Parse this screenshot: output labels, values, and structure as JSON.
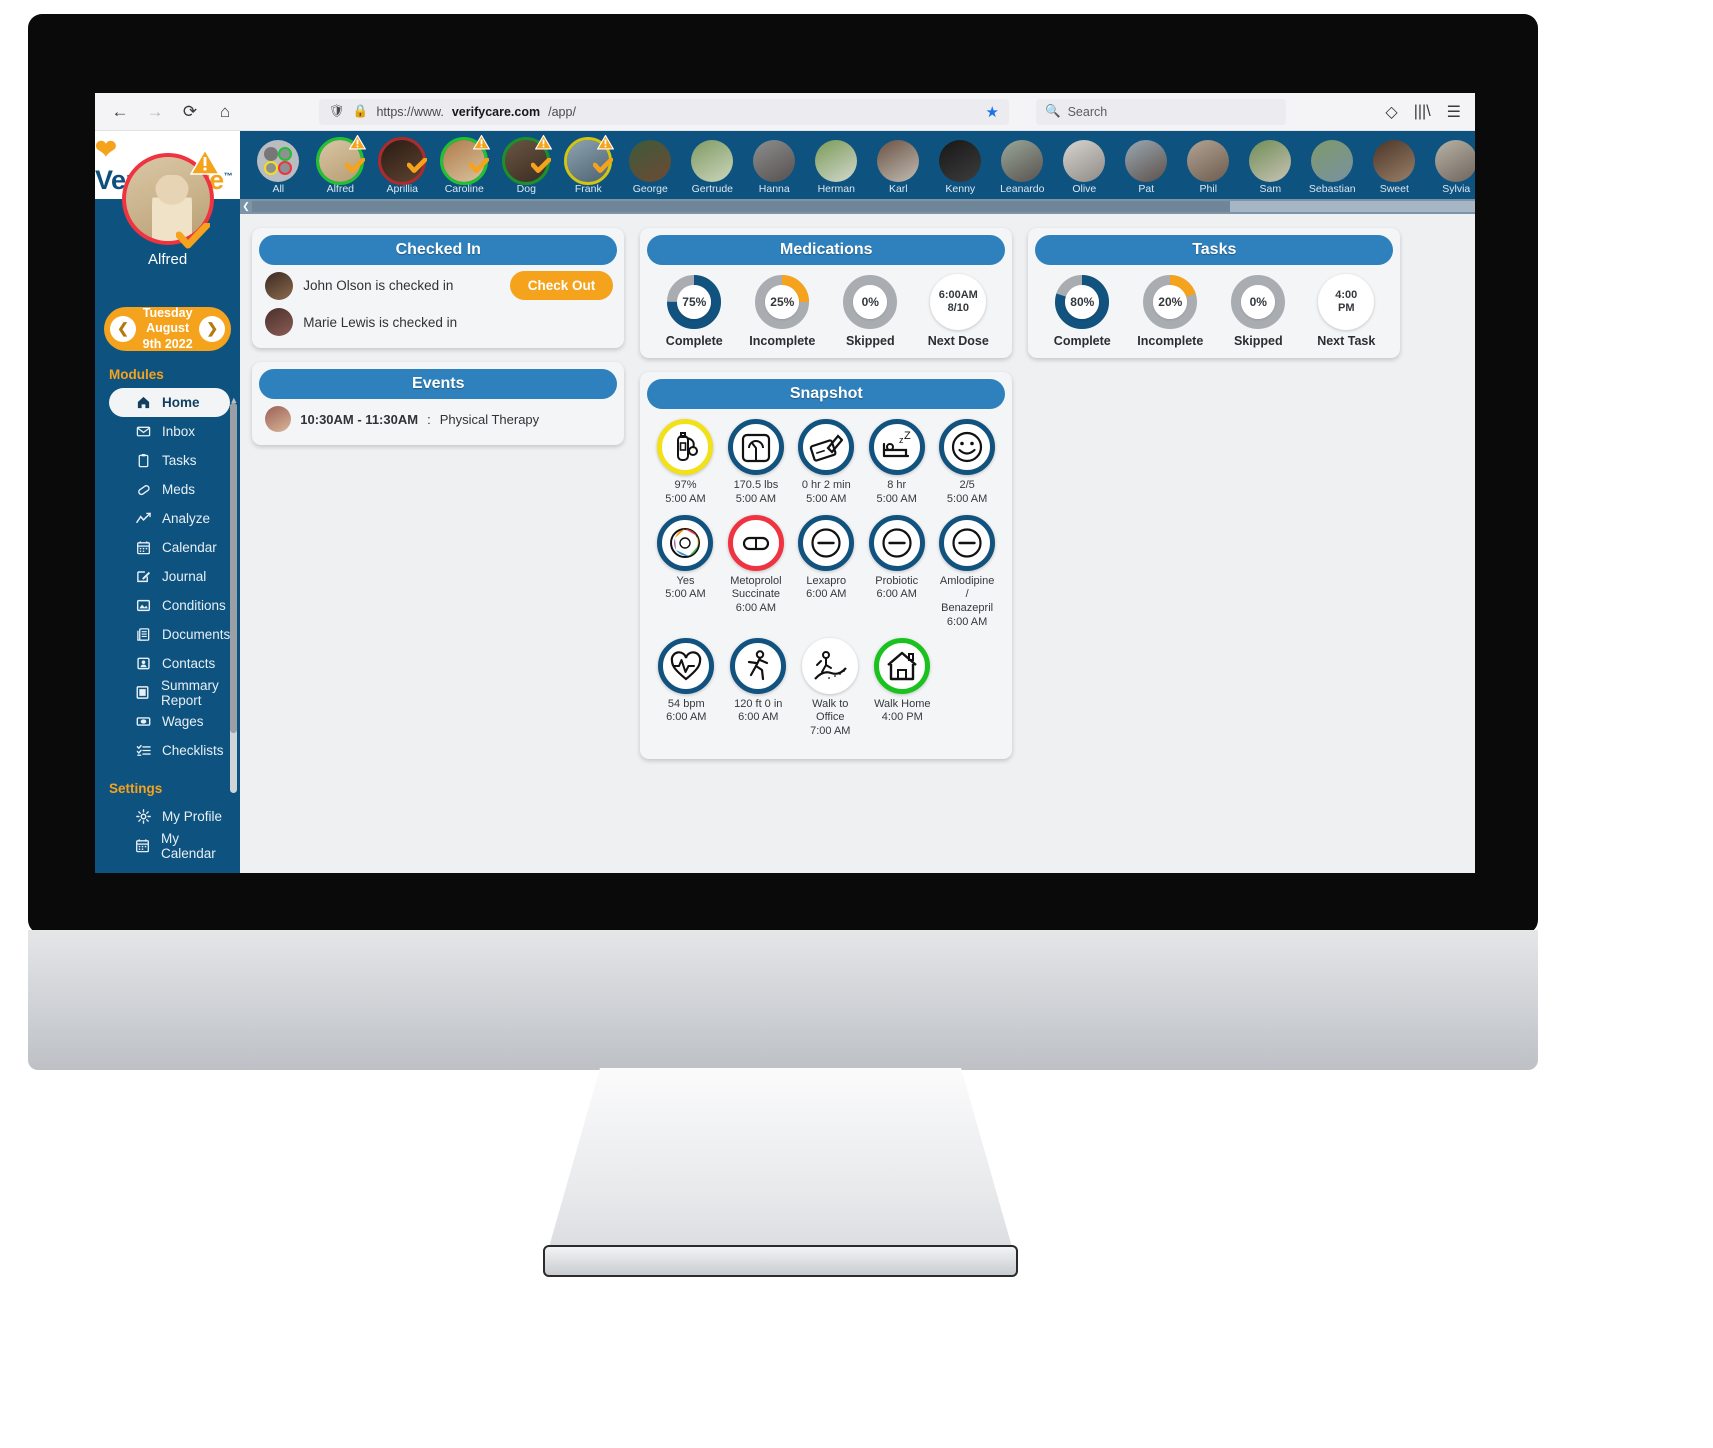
{
  "browser": {
    "back_icon": "back-arrow-icon",
    "forward_icon": "forward-arrow-icon",
    "reload_icon": "reload-icon",
    "home_icon": "home-icon",
    "url_prefix": "https://www.",
    "url_host": "verifycare.com",
    "url_path": "/app/",
    "shield_icon": "shield-icon",
    "lock_icon": "lock-icon",
    "bookmark_star_icon": "star-icon",
    "search_placeholder": "Search",
    "search_icon": "search-icon",
    "pocket_icon": "pocket-icon",
    "library_icon": "library-icon",
    "menu_icon": "hamburger-menu-icon"
  },
  "brand": {
    "name_v": "V",
    "name_erify": "erify",
    "name_care": "Care",
    "tm": "™"
  },
  "profile": {
    "name": "Alfred",
    "date_day": "Tuesday",
    "date_full": "August 9th 2022",
    "prev_icon": "chevron-left-icon",
    "next_icon": "chevron-right-icon",
    "alert_icon": "warning-triangle-icon",
    "verified_icon": "check-mark-icon"
  },
  "sidebar": {
    "modules_label": "Modules",
    "settings_label": "Settings",
    "modules": [
      {
        "label": "Home",
        "icon": "home-icon",
        "active": true
      },
      {
        "label": "Inbox",
        "icon": "envelope-icon",
        "active": false
      },
      {
        "label": "Tasks",
        "icon": "clipboard-icon",
        "active": false
      },
      {
        "label": "Meds",
        "icon": "pill-icon",
        "active": false
      },
      {
        "label": "Analyze",
        "icon": "chart-line-icon",
        "active": false
      },
      {
        "label": "Calendar",
        "icon": "calendar-icon",
        "active": false
      },
      {
        "label": "Journal",
        "icon": "pencil-square-icon",
        "active": false
      },
      {
        "label": "Conditions",
        "icon": "image-frame-icon",
        "active": false
      },
      {
        "label": "Documents",
        "icon": "documents-icon",
        "active": false
      },
      {
        "label": "Contacts",
        "icon": "contact-card-icon",
        "active": false
      },
      {
        "label": "Summary Report",
        "icon": "report-icon",
        "active": false
      },
      {
        "label": "Wages",
        "icon": "money-icon",
        "active": false
      },
      {
        "label": "Checklists",
        "icon": "checklist-icon",
        "active": false
      }
    ],
    "settings": [
      {
        "label": "My Profile",
        "icon": "gear-icon"
      },
      {
        "label": "My Calendar",
        "icon": "calendar-icon"
      }
    ]
  },
  "patients": [
    {
      "label": "All",
      "ring": "none",
      "warn": false,
      "check": false,
      "c1": "#cfd2d5",
      "c2": "#b4b8bc"
    },
    {
      "label": "Alfred",
      "ring": "#22c132",
      "warn": true,
      "check": true,
      "c1": "#d8c6a4",
      "c2": "#b79d73"
    },
    {
      "label": "Aprillia",
      "ring": "#b02a2a",
      "warn": false,
      "check": true,
      "c1": "#2a1b13",
      "c2": "#5e4330"
    },
    {
      "label": "Caroline",
      "ring": "#22c132",
      "warn": true,
      "check": true,
      "c1": "#b07a4a",
      "c2": "#d9c39e"
    },
    {
      "label": "Dog",
      "ring": "#1f8f2a",
      "warn": true,
      "check": true,
      "c1": "#6b5542",
      "c2": "#3b2d22"
    },
    {
      "label": "Frank",
      "ring": "#d2c413",
      "warn": true,
      "check": true,
      "c1": "#8fa3b2",
      "c2": "#4d6372"
    },
    {
      "label": "George",
      "ring": "none",
      "warn": false,
      "check": false,
      "c1": "#3e5a3a",
      "c2": "#6c4a35"
    },
    {
      "label": "Gertrude",
      "ring": "none",
      "warn": false,
      "check": false,
      "c1": "#7f9a63",
      "c2": "#cbd6bb"
    },
    {
      "label": "Hanna",
      "ring": "none",
      "warn": false,
      "check": false,
      "c1": "#8e8e8e",
      "c2": "#55504f"
    },
    {
      "label": "Herman",
      "ring": "none",
      "warn": false,
      "check": false,
      "c1": "#7a9a55",
      "c2": "#d3d8cf"
    },
    {
      "label": "Karl",
      "ring": "none",
      "warn": false,
      "check": false,
      "c1": "#6a5244",
      "c2": "#c2bcb2"
    },
    {
      "label": "Kenny",
      "ring": "none",
      "warn": false,
      "check": false,
      "c1": "#171717",
      "c2": "#3d3d3d"
    },
    {
      "label": "Leanardo",
      "ring": "none",
      "warn": false,
      "check": false,
      "c1": "#9aa79a",
      "c2": "#58524e"
    },
    {
      "label": "Olive",
      "ring": "none",
      "warn": false,
      "check": false,
      "c1": "#d7d5d1",
      "c2": "#8e8a85"
    },
    {
      "label": "Pat",
      "ring": "none",
      "warn": false,
      "check": false,
      "c1": "#9aa9b4",
      "c2": "#5e5049"
    },
    {
      "label": "Phil",
      "ring": "none",
      "warn": false,
      "check": false,
      "c1": "#b2a392",
      "c2": "#6b5c50"
    },
    {
      "label": "Sam",
      "ring": "none",
      "warn": false,
      "check": false,
      "c1": "#6f8d56",
      "c2": "#c9c3b4"
    },
    {
      "label": "Sebastian",
      "ring": "none",
      "warn": false,
      "check": false,
      "c1": "#7e9a6c",
      "c2": "#79919f"
    },
    {
      "label": "Sweet",
      "ring": "none",
      "warn": false,
      "check": false,
      "c1": "#4a3527",
      "c2": "#9a8069"
    },
    {
      "label": "Sylvia",
      "ring": "none",
      "warn": false,
      "check": false,
      "c1": "#b9b2a6",
      "c2": "#6d655c"
    }
  ],
  "checked_in": {
    "title": "Checked In",
    "check_out_label": "Check Out",
    "rows": [
      {
        "text": "John Olson is checked in",
        "has_button": true,
        "c1": "#3a2a22",
        "c2": "#8d6b4e"
      },
      {
        "text": "Marie Lewis is checked in",
        "has_button": false,
        "c1": "#4b2f2a",
        "c2": "#8a5d57"
      }
    ]
  },
  "events": {
    "title": "Events",
    "rows": [
      {
        "time": "10:30AM - 11:30AM",
        "sep": ": ",
        "text": "Physical Therapy",
        "c1": "#9b5f55",
        "c2": "#d9b89a"
      }
    ]
  },
  "medications": {
    "title": "Medications",
    "cells": [
      {
        "kind": "donut",
        "value": "75%",
        "label": "Complete",
        "pct": 75,
        "color": "#12527f",
        "track": "#a9adb1"
      },
      {
        "kind": "donut",
        "value": "25%",
        "label": "Incomplete",
        "pct": 25,
        "color": "#f5a21d",
        "track": "#a9adb1"
      },
      {
        "kind": "donut",
        "value": "0%",
        "label": "Skipped",
        "pct": 0,
        "color": "#a9adb1",
        "track": "#a9adb1"
      },
      {
        "kind": "plain",
        "line1": "6:00AM",
        "line2": "8/10",
        "label": "Next Dose"
      }
    ]
  },
  "tasks": {
    "title": "Tasks",
    "cells": [
      {
        "kind": "donut",
        "value": "80%",
        "label": "Complete",
        "pct": 80,
        "color": "#12527f",
        "track": "#a9adb1"
      },
      {
        "kind": "donut",
        "value": "20%",
        "label": "Incomplete",
        "pct": 20,
        "color": "#f5a21d",
        "track": "#a9adb1"
      },
      {
        "kind": "donut",
        "value": "0%",
        "label": "Skipped",
        "pct": 0,
        "color": "#a9adb1",
        "track": "#a9adb1"
      },
      {
        "kind": "plain",
        "line1": "4:00",
        "line2": "PM",
        "label": "Next Task"
      }
    ]
  },
  "snapshot": {
    "title": "Snapshot",
    "rows": [
      [
        {
          "icon": "oxygen-tank-icon",
          "ring": "#f2e018",
          "lines": [
            "97%",
            "5:00 AM"
          ]
        },
        {
          "icon": "weight-scale-icon",
          "ring": "#12527f",
          "lines": [
            "170.5 lbs",
            "5:00 AM"
          ]
        },
        {
          "icon": "journal-pencil-icon",
          "ring": "#12527f",
          "lines": [
            "0 hr 2 min",
            "5:00 AM"
          ]
        },
        {
          "icon": "sleep-bed-icon",
          "ring": "#12527f",
          "lines": [
            "8 hr",
            "5:00 AM"
          ]
        },
        {
          "icon": "smiley-face-icon",
          "ring": "#12527f",
          "lines": [
            "2/5",
            "5:00 AM"
          ]
        }
      ],
      [
        {
          "icon": "food-plate-icon",
          "ring": "#12527f",
          "lines": [
            "Yes",
            "5:00 AM"
          ]
        },
        {
          "icon": "pill-capsule-icon",
          "ring": "#ef3340",
          "lines": [
            "Metoprolol",
            "Succinate",
            "6:00 AM"
          ]
        },
        {
          "icon": "minus-circle-icon",
          "ring": "#12527f",
          "lines": [
            "Lexapro",
            "6:00 AM"
          ]
        },
        {
          "icon": "minus-circle-icon",
          "ring": "#12527f",
          "lines": [
            "Probiotic",
            "6:00 AM"
          ]
        },
        {
          "icon": "minus-circle-icon",
          "ring": "#12527f",
          "lines": [
            "Amlodipine /",
            "Benazepril",
            "6:00 AM"
          ]
        }
      ],
      [
        {
          "icon": "heart-pulse-icon",
          "ring": "#12527f",
          "lines": [
            "54 bpm",
            "6:00 AM"
          ]
        },
        {
          "icon": "walking-person-icon",
          "ring": "#12527f",
          "lines": [
            "120 ft 0 in",
            "6:00 AM"
          ]
        },
        {
          "icon": "hiking-trail-icon",
          "ring": "#ffffff",
          "lines": [
            "Walk to Office",
            "7:00 AM"
          ]
        },
        {
          "icon": "house-icon",
          "ring": "#19c21e",
          "lines": [
            "Walk Home",
            "4:00 PM"
          ]
        }
      ]
    ]
  }
}
